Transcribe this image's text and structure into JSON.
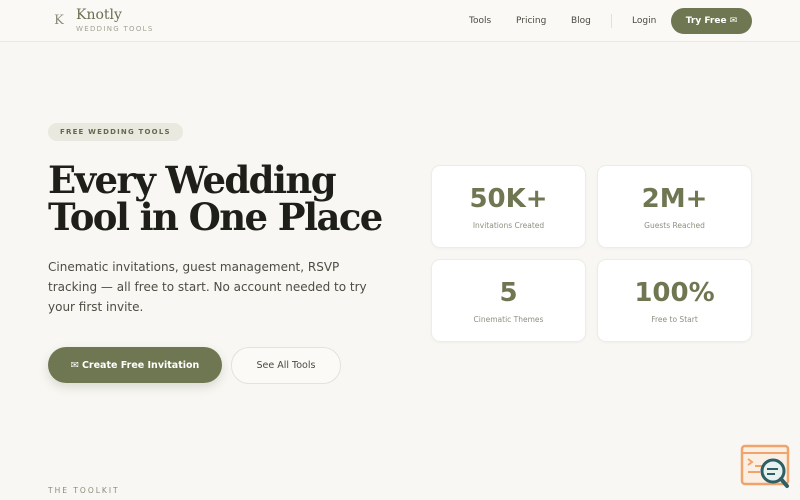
{
  "header": {
    "brand": "Knotly",
    "brand_sub": "WEDDING TOOLS",
    "logo_glyph": "K",
    "nav": {
      "tools": "Tools",
      "pricing": "Pricing",
      "blog": "Blog",
      "login": "Login"
    },
    "try_button": "Try Free ✉"
  },
  "hero": {
    "badge": "FREE WEDDING TOOLS",
    "headline_line1": "Every Wedding",
    "headline_line2": "Tool in One Place",
    "subtext": "Cinematic invitations, guest management, RSVP tracking — all free to start. No account needed to try your first invite.",
    "cta_primary": "✉ Create Free Invitation",
    "cta_secondary": "See All Tools"
  },
  "stats": [
    {
      "value": "50K+",
      "label": "Invitations Created"
    },
    {
      "value": "2M+",
      "label": "Guests Reached"
    },
    {
      "value": "5",
      "label": "Cinematic Themes"
    },
    {
      "value": "100%",
      "label": "Free to Start"
    }
  ],
  "section": {
    "toolkit_label": "THE TOOLKIT"
  },
  "colors": {
    "accent": "#6f7752",
    "background": "#f8f7f3",
    "widget_orange": "#f0a36a",
    "widget_teal": "#2d5f66"
  },
  "icons": {
    "logo": "knot-k-icon",
    "widget": "search-chat-widget-icon"
  }
}
